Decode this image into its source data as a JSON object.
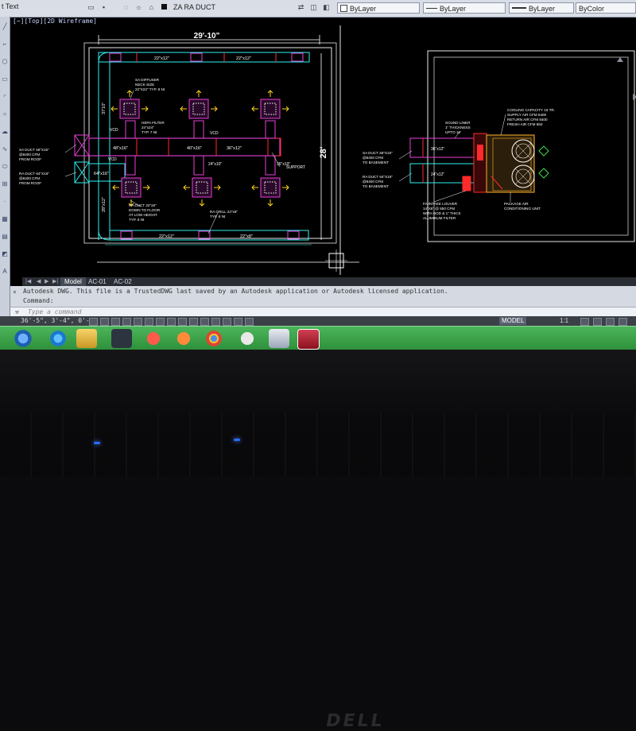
{
  "window": {
    "truncated_left_label": "t Text",
    "file_title": "ZA RA DUCT"
  },
  "properties_bar": {
    "layer": "ByLayer",
    "linetype": "ByLayer",
    "lineweight": "ByLayer",
    "color": "ByColor"
  },
  "viewport": {
    "label": "[−][Top][2D Wireframe]"
  },
  "drawing_left": {
    "overall_width": "29'-10\"",
    "overall_height": "28'",
    "left_height_dim": "37'10\"",
    "top_duct_sizes": [
      "22\"x12\"",
      "22\"x12\""
    ],
    "bottom_duct_sizes": [
      "22\"x12\"",
      "22\"x8\""
    ],
    "main_duct_sizes": [
      "48\"x16\"",
      "40\"x16\"",
      "36\"x12\""
    ],
    "branch_sizes": [
      "64\"x16\"",
      "24\"x10\"",
      "36\"x10\""
    ],
    "left_vertical_dim": "28\"x12\"",
    "vcd_label": "VCD",
    "note_diffuser": "SA DIFFUSER\nNECK SIZE\n22\"X22\" TYP. 8 Nt",
    "note_filter": "HEPA FILTER\n24\"x24\"\nTYP. 7 Nt",
    "note_sa_duct": "SA DUCT 48\"X16\"\n@8400 CFM\nFROM ROOF",
    "note_ra_duct": "RA DUCT 64\"X16\"\n@8400 CFM\nFROM ROOF",
    "note_ra_duct_down": "RA DUCT 22\"x8\"\nDOWN TO FLOOR\nAT LOW HEIGHT\nTYP. 8 Nt",
    "note_ra_grill": "RA GRILL 22\"x8\"\nTYP. 8 Nt",
    "note_support": "SUPPORT"
  },
  "drawing_right": {
    "note_cooling": "COOLING CAPACITY 15 TR.\nSUPPLY AIR CFM 8400\nRETURN AIR CFM 8400\nFRESH AIR CFM 850",
    "note_sound_liner": "SOUND LINER\n1\" THICKNESS\nUPTO 10'",
    "note_sa_duct_basement": "SA DUCT 48\"X16\"\n@8400 CFM\nTO BASEMENT",
    "note_ra_duct_basement": "RA DUCT 64\"X16\"\n@8400 CFM\nTO BASEMENT",
    "note_fa_louver": "FA INTAKE LOUVER\n14\"X8\" @ 850 CFM\nWITH BOD & 1\" THICK\nALUMINUM FILTER",
    "note_package_unit": "PACKAGE AIR\nCONDITIONING UNIT",
    "duct_sizes": [
      "36\"x12\"",
      "24\"x12\""
    ]
  },
  "layout_tabs": {
    "model": "Model",
    "tab1": "AC-01",
    "tab2": "AC-02"
  },
  "command": {
    "history_line": "Autodesk DWG.  This file is a TrustedDWG last saved by an Autodesk application or Autodesk licensed application.",
    "prompt_label": "Command:",
    "input_placeholder": "Type a command"
  },
  "status": {
    "coordinates": "36'-5\", 3'-4\", 0'-0\"",
    "model_label": "MODEL",
    "scale": "1:1"
  },
  "colors": {
    "duct_cyan": "#2ef0f0",
    "duct_magenta": "#e93fd9",
    "duct_red": "#ff2a2a",
    "dimension_white": "#ffffff",
    "arrow_yellow": "#ffd21e",
    "green_marks": "#39e04a",
    "taskbar_green": "#3aa84a"
  },
  "taskbar_icons": [
    "start-orb-icon",
    "ie-icon",
    "explorer-icon",
    "network-icon",
    "opera-icon",
    "media-player-icon",
    "chrome-icon",
    "cd-icon",
    "file-manager-icon",
    "autocad-icon"
  ]
}
